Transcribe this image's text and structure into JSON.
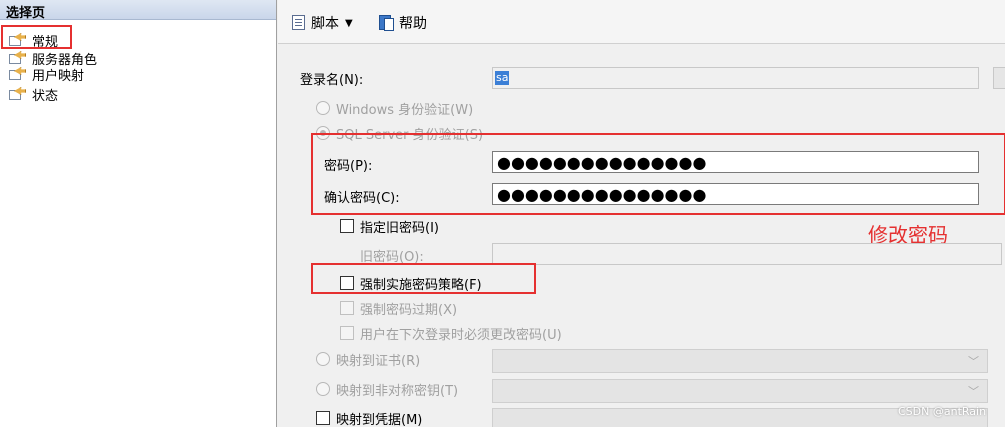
{
  "left_panel": {
    "header": "选择页",
    "items": [
      {
        "label": "常规"
      },
      {
        "label": "服务器角色"
      },
      {
        "label": "用户映射"
      },
      {
        "label": "状态"
      }
    ]
  },
  "toolbar": {
    "script_label": "脚本",
    "help_label": "帮助"
  },
  "form": {
    "login_name_label": "登录名(N):",
    "login_name_value": "sa",
    "windows_auth_label": "Windows 身份验证(W)",
    "sql_auth_label": "SQL Server 身份验证(S)",
    "password_label": "密码(P):",
    "password_value": "●●●●●●●●●●●●●●●",
    "confirm_password_label": "确认密码(C):",
    "confirm_password_value": "●●●●●●●●●●●●●●●",
    "specify_old_password_label": "指定旧密码(I)",
    "old_password_label": "旧密码(O):",
    "enforce_policy_label": "强制实施密码策略(F)",
    "enforce_expiration_label": "强制密码过期(X)",
    "must_change_label": "用户在下次登录时必须更改密码(U)",
    "map_certificate_label": "映射到证书(R)",
    "map_asym_key_label": "映射到非对称密钥(T)",
    "map_credential_label": "映射到凭据(M)"
  },
  "annotation": {
    "text": "修改密码",
    "color": "#e53030"
  },
  "watermark": "CSDN @antRain"
}
